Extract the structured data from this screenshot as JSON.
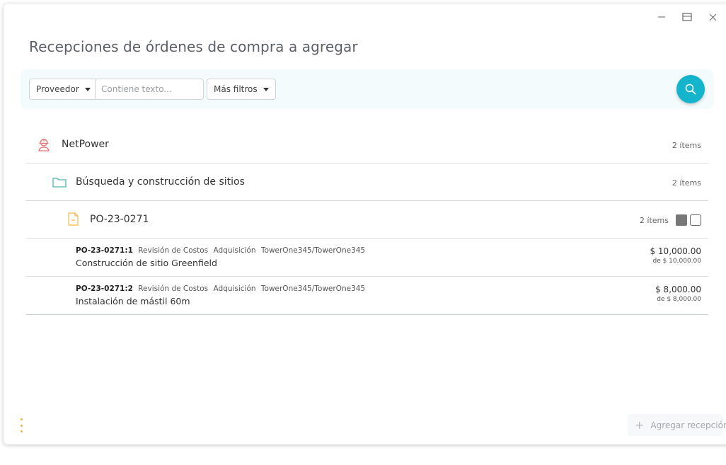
{
  "window": {
    "title": "Recepciones de órdenes de compra a agregar"
  },
  "filters": {
    "provider_label": "Proveedor",
    "text_placeholder": "Contiene texto...",
    "more_filters_label": "Más filtros"
  },
  "tree": {
    "vendor": {
      "name": "NetPower",
      "count": "2 ítems"
    },
    "project": {
      "name": "Búsqueda y construcción de sitios",
      "count": "2 ítems"
    },
    "order": {
      "name": "PO-23-0271",
      "count": "2 ítems"
    }
  },
  "items": [
    {
      "code": "PO-23-0271:1",
      "tag1": "Revisión de Costos",
      "tag2": "Adquisición",
      "tag3": "TowerOne345/TowerOne345",
      "description": "Construcción de sitio Greenfield",
      "amount": "$ 10,000.00",
      "of_amount": "de $ 10,000.00"
    },
    {
      "code": "PO-23-0271:2",
      "tag1": "Revisión de Costos",
      "tag2": "Adquisición",
      "tag3": "TowerOne345/TowerOne345",
      "description": "Instalación de mástil 60m",
      "amount": "$ 8,000.00",
      "of_amount": "de $ 8,000.00"
    }
  ],
  "footer": {
    "add_label": "Agregar recepción"
  },
  "colors": {
    "accent": "#14b4cc",
    "vendor_icon": "#e57373",
    "folder_icon": "#4db6ac",
    "doc_icon": "#f5b94a",
    "kebab": "#f2b441"
  },
  "icons": {
    "minimize": "minimize-icon",
    "maximize": "maximize-icon",
    "close": "close-icon",
    "search": "search-icon",
    "vendor": "worker-icon",
    "project": "folder-icon",
    "order": "document-icon",
    "more": "kebab-menu-icon",
    "add": "plus-icon"
  }
}
